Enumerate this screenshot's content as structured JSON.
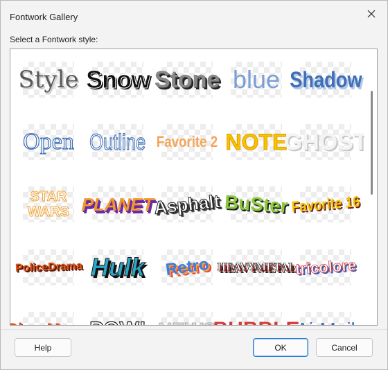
{
  "window": {
    "title": "Fontwork Gallery"
  },
  "prompt": "Select a Fontwork style:",
  "gallery": {
    "items": [
      {
        "label": "Style"
      },
      {
        "label": "Snow"
      },
      {
        "label": "Stone"
      },
      {
        "label": "blue"
      },
      {
        "label": "Shadow"
      },
      {
        "label": "Open"
      },
      {
        "label": "Outline"
      },
      {
        "label": "Favorite 2"
      },
      {
        "label": "NOTE"
      },
      {
        "label": "GHOST"
      },
      {
        "label": "STAR WARS"
      },
      {
        "label": "PLANET"
      },
      {
        "label": "Asphalt"
      },
      {
        "label": "BuSter"
      },
      {
        "label": "Favorite 16"
      },
      {
        "label": "PoliceDrama"
      },
      {
        "label": "Hulk"
      },
      {
        "label": "Retro"
      },
      {
        "label": "HEAVYMETAL"
      },
      {
        "label": "tricolore"
      },
      {
        "label": "Blue Moon"
      },
      {
        "label": "POW!"
      },
      {
        "label": "NEWS"
      },
      {
        "label": "BUBBLE"
      },
      {
        "label": "AirMail"
      }
    ]
  },
  "buttons": {
    "help": "Help",
    "ok": "OK",
    "cancel": "Cancel"
  }
}
